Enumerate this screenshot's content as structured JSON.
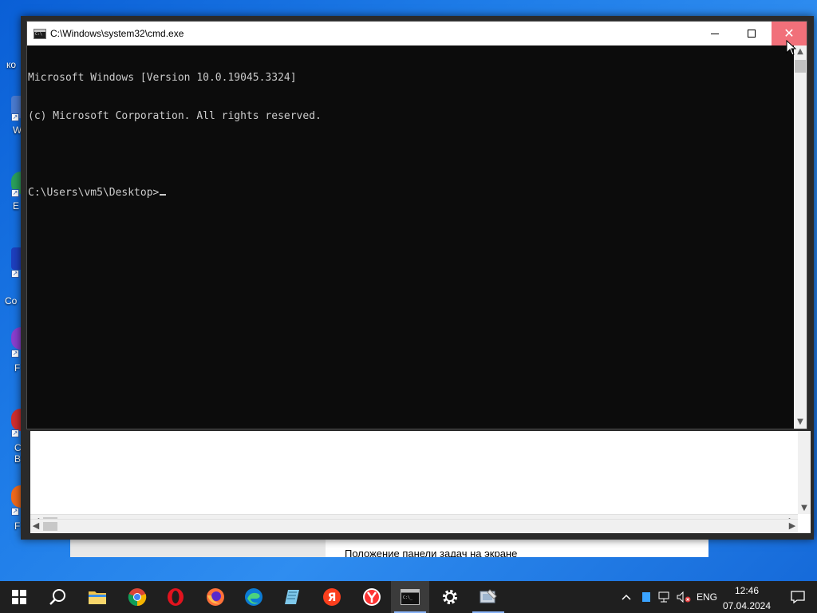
{
  "desktop": {
    "icon_labels": [
      "ко",
      "W",
      "E",
      "Co",
      "F",
      "C",
      "B",
      "F"
    ],
    "background_window_text": "Положение панели задач на экране"
  },
  "cmd_window": {
    "title": "C:\\Windows\\system32\\cmd.exe",
    "minimize_symbol": "—",
    "maximize_symbol": "☐",
    "close_symbol": "✕",
    "console_lines": [
      "Microsoft Windows [Version 10.0.19045.3324]",
      "(c) Microsoft Corporation. All rights reserved.",
      "",
      "C:\\Users\\vm5\\Desktop>"
    ]
  },
  "taskbar": {
    "apps": [
      {
        "name": "start",
        "icon": "windows-logo-icon"
      },
      {
        "name": "search",
        "icon": "search-icon"
      },
      {
        "name": "file-explorer",
        "icon": "folder-icon"
      },
      {
        "name": "chrome",
        "icon": "chrome-icon"
      },
      {
        "name": "opera",
        "icon": "opera-icon"
      },
      {
        "name": "firefox",
        "icon": "firefox-icon"
      },
      {
        "name": "edge",
        "icon": "edge-icon"
      },
      {
        "name": "notepad",
        "icon": "notepad-icon"
      },
      {
        "name": "yandex",
        "icon": "yandex-icon"
      },
      {
        "name": "yandex-browser",
        "icon": "yandex-browser-icon"
      },
      {
        "name": "cmd",
        "icon": "terminal-icon"
      },
      {
        "name": "settings",
        "icon": "gear-icon"
      },
      {
        "name": "control-panel",
        "icon": "control-panel-icon"
      }
    ],
    "tray": {
      "chevron": "^",
      "language": "ENG",
      "time": "12:46",
      "date": "07.04.2024"
    }
  },
  "colors": {
    "desktop_bg": "#1f7de8",
    "console_bg": "#0c0c0c",
    "console_text": "#cccccc",
    "close_hover": "#f1707a",
    "taskbar_bg": "#1f1f1f"
  }
}
